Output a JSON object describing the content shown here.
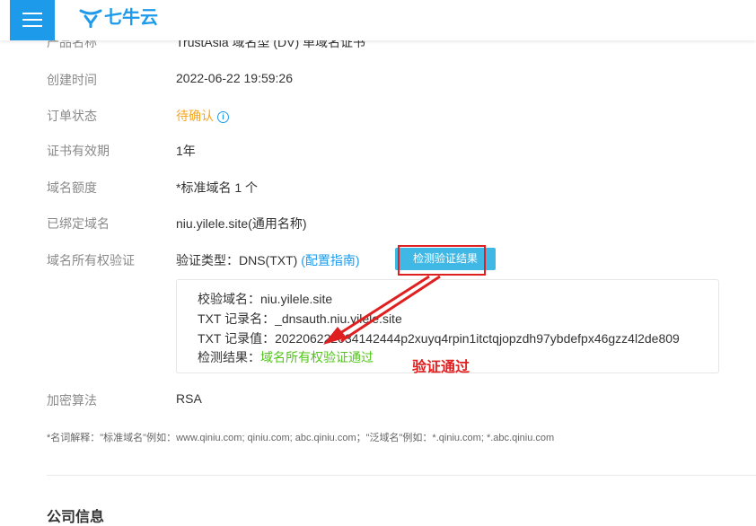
{
  "brand": {
    "logo_text": "七牛云",
    "accent": "#1d9bea"
  },
  "header": {
    "menu_icon": "hamburger-menu-icon"
  },
  "rows": [
    {
      "label": "产品名称",
      "value": "TrustAsia 域名型 (DV) 单域名证书"
    },
    {
      "label": "创建时间",
      "value": "2022-06-22 19:59:26"
    },
    {
      "label": "订单状态",
      "value": "待确认"
    },
    {
      "label": "证书有效期",
      "value": "1年"
    },
    {
      "label": "域名额度",
      "value": "*标准域名 1 个"
    },
    {
      "label": "已绑定域名",
      "value": "niu.yilele.site(通用名称)"
    },
    {
      "label": "域名所有权验证",
      "value": "验证类型：DNS(TXT)"
    },
    {
      "label": "加密算法",
      "value": "RSA"
    }
  ],
  "verification": {
    "guide_link": "(配置指南)",
    "check_button": "检测验证结果",
    "domain_label": "校验域名：",
    "domain_value": "niu.yilele.site",
    "record_name_label": "TXT 记录名：",
    "record_name_value": "_dnsauth.niu.yilele.site",
    "record_value_label": "TXT 记录值：",
    "record_value_value": "202206222034142444p2xuyq4rpin1itctqjopzdh97ybdefpx46gzz4l2de809",
    "result_label": "检测结果：",
    "result_value": "域名所有权验证通过",
    "annotation": "验证通过",
    "annotation_color": "#e02020",
    "success_color": "#52c41a"
  },
  "footnote": "*名词解释：\"标准域名\"例如：www.qiniu.com; qiniu.com; abc.qiniu.com；\"泛域名\"例如：*.qiniu.com; *.abc.qiniu.com",
  "next_section_title": "公司信息"
}
